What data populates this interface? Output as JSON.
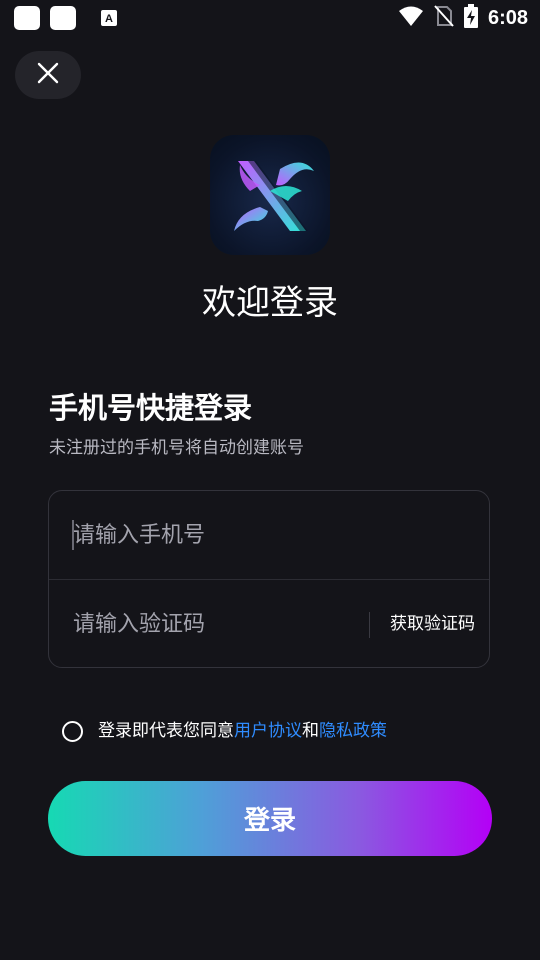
{
  "status_bar": {
    "time": "6:08",
    "icons": [
      "app-square-icon",
      "app-square-icon",
      "a-notification-icon",
      "wifi-icon",
      "no-sim-icon",
      "battery-charging-icon"
    ]
  },
  "header": {
    "close_icon": "close-icon"
  },
  "logo": {
    "icon": "app-logo-icon",
    "colors": [
      "#2ee6d6",
      "#c25cff",
      "#0b1428"
    ]
  },
  "welcome": "欢迎登录",
  "quick_login": {
    "title": "手机号快捷登录",
    "subtitle": "未注册过的手机号将自动创建账号"
  },
  "form": {
    "phone_placeholder": "请输入手机号",
    "phone_value": "",
    "code_placeholder": "请输入验证码",
    "code_value": "",
    "get_code_label": "获取验证码"
  },
  "agreement": {
    "prefix": "登录即代表您同意 ",
    "user_agreement": "用户协议",
    "conjunction": "和",
    "privacy_policy": "隐私政策",
    "link_color": "#2f8cff"
  },
  "login_button": {
    "label": "登录",
    "gradient": [
      "#16d9b3",
      "#b400f6"
    ]
  }
}
